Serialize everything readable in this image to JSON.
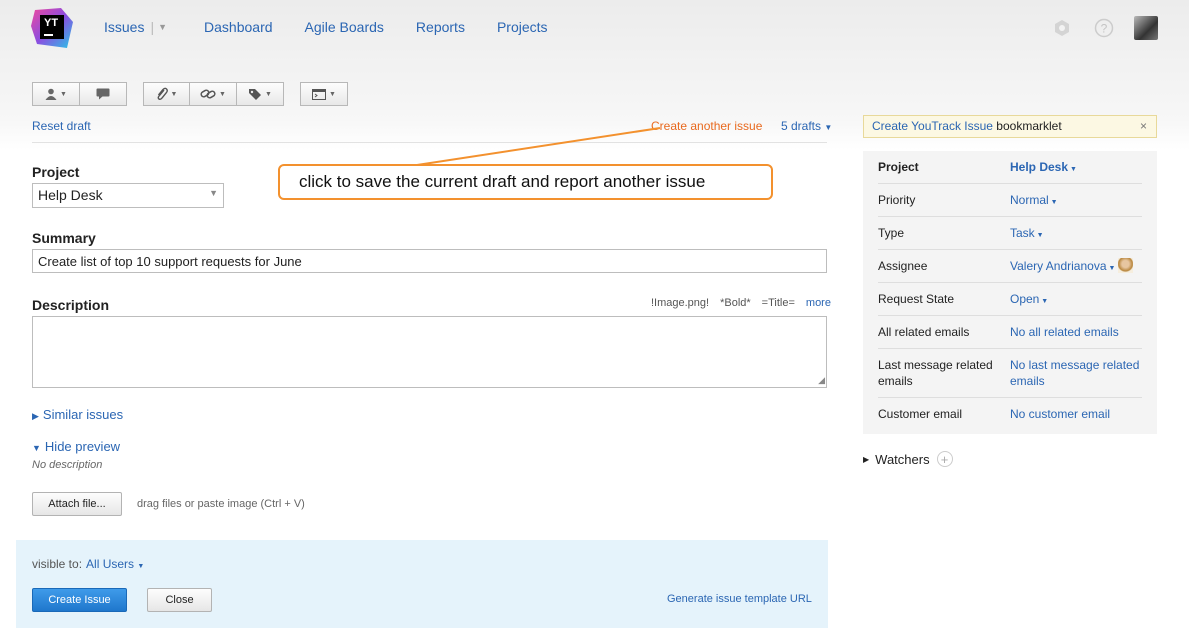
{
  "header": {
    "logo_text": "YT",
    "nav": {
      "issues": "Issues",
      "dashboard": "Dashboard",
      "agile_boards": "Agile Boards",
      "reports": "Reports",
      "projects": "Projects"
    }
  },
  "toolbar": {
    "groups": [
      [
        "user-icon",
        "comment-icon"
      ],
      [
        "paperclip-icon",
        "link-icon",
        "tag-icon"
      ],
      [
        "command-icon"
      ]
    ]
  },
  "draft": {
    "reset": "Reset draft",
    "create_another": "Create another issue",
    "drafts": "5 drafts"
  },
  "callout": "click to save the current draft and report another issue",
  "form": {
    "project_label": "Project",
    "project_value": "Help Desk",
    "summary_label": "Summary",
    "summary_value": "Create list of top 10 support requests for June",
    "description_label": "Description",
    "markup_hints": [
      "!Image.png!",
      "*Bold*",
      "=Title="
    ],
    "more": "more",
    "similar_issues": "Similar issues",
    "hide_preview": "Hide preview",
    "no_description": "No description",
    "attach_file": "Attach file...",
    "drag_hint": "drag files or paste image (Ctrl + V)"
  },
  "footer": {
    "visible_to_label": "visible to:",
    "visible_to_value": "All Users",
    "create_issue": "Create Issue",
    "close": "Close",
    "generate_url": "Generate issue template URL"
  },
  "sidebar": {
    "bookmarklet_link": "Create YouTrack Issue",
    "bookmarklet_text": " bookmarklet",
    "bookmarklet_close": "×",
    "fields": [
      {
        "key": "Project",
        "value": "Help Desk",
        "dropdown": true
      },
      {
        "key": "Priority",
        "value": "Normal",
        "dropdown": true
      },
      {
        "key": "Type",
        "value": "Task",
        "dropdown": true
      },
      {
        "key": "Assignee",
        "value": "Valery Andrianova",
        "dropdown": true
      },
      {
        "key": "Request State",
        "value": "Open",
        "dropdown": true
      },
      {
        "key": "All related emails",
        "value": "No all related emails",
        "dropdown": false
      },
      {
        "key": "Last message related emails",
        "value": "No last message related emails",
        "dropdown": false
      },
      {
        "key": "Customer email",
        "value": "No customer email",
        "dropdown": false
      }
    ],
    "watchers": "Watchers"
  },
  "colors": {
    "link": "#2b66b3",
    "accent_orange": "#e8691e",
    "callout_border": "#f3912e",
    "primary_button": "#1f77cc",
    "footer_bg": "#e5f3fb",
    "bookmarklet_bg": "#fcf8e3"
  }
}
